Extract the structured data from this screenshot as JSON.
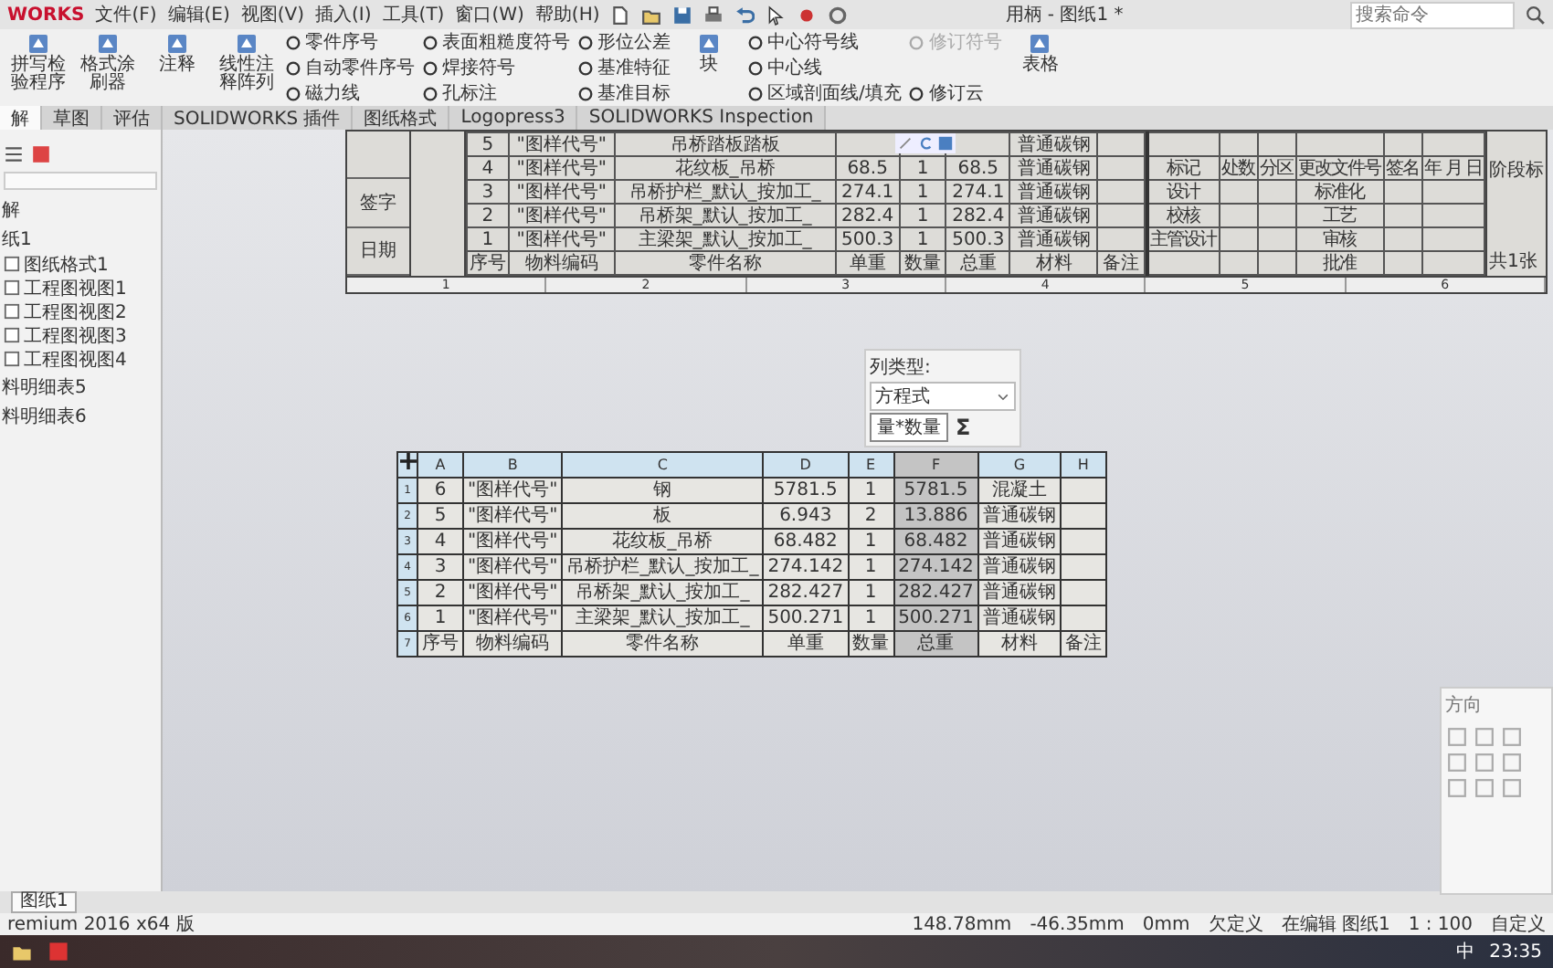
{
  "app": {
    "logo": "WORKS",
    "menus": [
      "文件(F)",
      "编辑(E)",
      "视图(V)",
      "插入(I)",
      "工具(T)",
      "窗口(W)",
      "帮助(H)"
    ],
    "title": "用柄 - 图纸1 *",
    "search": {
      "placeholder": "搜索命令"
    }
  },
  "ribbon": [
    {
      "kind": "large",
      "label": "拼写检验程序"
    },
    {
      "kind": "large",
      "label": "格式涂刷器"
    },
    {
      "kind": "large",
      "label": "注释"
    },
    {
      "kind": "large",
      "label": "线性注释阵列"
    },
    {
      "kind": "stack",
      "items": [
        {
          "label": "零件序号",
          "disabled": false
        },
        {
          "label": "自动零件序号",
          "disabled": false
        },
        {
          "label": "磁力线",
          "disabled": false
        }
      ]
    },
    {
      "kind": "stack",
      "items": [
        {
          "label": "表面粗糙度符号",
          "disabled": false
        },
        {
          "label": "焊接符号",
          "disabled": false
        },
        {
          "label": "孔标注",
          "disabled": false
        }
      ]
    },
    {
      "kind": "stack",
      "items": [
        {
          "label": "形位公差",
          "disabled": false
        },
        {
          "label": "基准特征",
          "disabled": false
        },
        {
          "label": "基准目标",
          "disabled": false
        }
      ]
    },
    {
      "kind": "large",
      "label": "块"
    },
    {
      "kind": "stack",
      "items": [
        {
          "label": "中心符号线",
          "disabled": false
        },
        {
          "label": "中心线",
          "disabled": false
        },
        {
          "label": "区域剖面线/填充",
          "disabled": false
        }
      ]
    },
    {
      "kind": "stack",
      "items": [
        {
          "label": "修订符号",
          "disabled": true
        },
        {
          "label": "修订云",
          "disabled": false
        }
      ]
    },
    {
      "kind": "large",
      "label": "表格"
    }
  ],
  "tabs": [
    {
      "label": "解",
      "selected": true
    },
    {
      "label": "草图",
      "selected": false
    },
    {
      "label": "评估",
      "selected": false
    },
    {
      "label": "SOLIDWORKS 插件",
      "selected": false
    },
    {
      "label": "图纸格式",
      "selected": false
    },
    {
      "label": "Logopress3",
      "selected": false
    },
    {
      "label": "SOLIDWORKS Inspection",
      "selected": false
    }
  ],
  "tree": [
    {
      "label": "解"
    },
    {
      "label": "纸1",
      "children": [
        {
          "label": "图纸格式1"
        },
        {
          "label": "工程图视图1"
        },
        {
          "label": "工程图视图2"
        },
        {
          "label": "工程图视图3"
        },
        {
          "label": "工程图视图4"
        }
      ]
    },
    {
      "label": "料明细表5"
    },
    {
      "label": "料明细表6"
    }
  ],
  "title_block": {
    "left_labels": [
      "签字",
      "日期"
    ],
    "bom_rows": [
      {
        "no": "5",
        "code": "\"图样代号\"",
        "name": "吊桥踏板踏板",
        "material": "普通碳钢"
      },
      {
        "no": "4",
        "code": "\"图样代号\"",
        "name": "花纹板_吊桥",
        "unit": "68.5",
        "qty": "1",
        "total": "68.5",
        "material": "普通碳钢"
      },
      {
        "no": "3",
        "code": "\"图样代号\"",
        "name": "吊桥护栏_默认_按加工_",
        "unit": "274.1",
        "qty": "1",
        "total": "274.1",
        "material": "普通碳钢"
      },
      {
        "no": "2",
        "code": "\"图样代号\"",
        "name": "吊桥架_默认_按加工_",
        "unit": "282.4",
        "qty": "1",
        "total": "282.4",
        "material": "普通碳钢"
      },
      {
        "no": "1",
        "code": "\"图样代号\"",
        "name": "主梁架_默认_按加工_",
        "unit": "500.3",
        "qty": "1",
        "total": "500.3",
        "material": "普通碳钢"
      }
    ],
    "bom_header": [
      "序号",
      "物料编码",
      "零件名称",
      "单重",
      "数量",
      "总重",
      "材料",
      "备注"
    ],
    "revision_header": [
      "标记",
      "处数",
      "分区",
      "更改文件号",
      "签名",
      "年 月 日"
    ],
    "approvals": [
      {
        "left": "设计",
        "right": "标准化"
      },
      {
        "left": "校核",
        "right": "工艺"
      },
      {
        "left": "主管设计",
        "right": "审核"
      },
      {
        "right": "批准"
      }
    ],
    "stage_label": "阶段标",
    "sheet_label": "共1张",
    "zones": [
      "1",
      "2",
      "3",
      "4",
      "5",
      "6"
    ]
  },
  "popup": {
    "label": "列类型:",
    "type": "方程式",
    "equation": "量*数量",
    "sum": "Σ"
  },
  "table": {
    "columns": [
      {
        "letter": "A",
        "selected": false
      },
      {
        "letter": "B",
        "selected": false
      },
      {
        "letter": "C",
        "selected": false
      },
      {
        "letter": "D",
        "selected": false
      },
      {
        "letter": "E",
        "selected": false
      },
      {
        "letter": "F",
        "selected": true
      },
      {
        "letter": "G",
        "selected": false
      },
      {
        "letter": "H",
        "selected": false
      }
    ],
    "row_numbers": [
      "1",
      "2",
      "3",
      "4",
      "5",
      "6",
      "7"
    ],
    "rows": [
      [
        "6",
        "\"图样代号\"",
        "钢",
        "5781.5",
        "1",
        "5781.5",
        "混凝土",
        ""
      ],
      [
        "5",
        "\"图样代号\"",
        "板",
        "6.943",
        "2",
        "13.886",
        "普通碳钢",
        ""
      ],
      [
        "4",
        "\"图样代号\"",
        "花纹板_吊桥",
        "68.482",
        "1",
        "68.482",
        "普通碳钢",
        ""
      ],
      [
        "3",
        "\"图样代号\"",
        "吊桥护栏_默认_按加工_",
        "274.142",
        "1",
        "274.142",
        "普通碳钢",
        ""
      ],
      [
        "2",
        "\"图样代号\"",
        "吊桥架_默认_按加工_",
        "282.427",
        "1",
        "282.427",
        "普通碳钢",
        ""
      ],
      [
        "1",
        "\"图样代号\"",
        "主梁架_默认_按加工_",
        "500.271",
        "1",
        "500.271",
        "普通碳钢",
        ""
      ],
      [
        "序号",
        "物料编码",
        "零件名称",
        "单重",
        "数量",
        "总重",
        "材料",
        "备注"
      ]
    ]
  },
  "orientation_panel": {
    "title": "方向"
  },
  "sheet_tab": "图纸1",
  "status": {
    "edition": "remium 2016 x64 版",
    "items": [
      "148.78mm",
      "-46.35mm",
      "0mm",
      "欠定义",
      "在编辑 图纸1",
      "1 : 100",
      "自定义"
    ]
  },
  "taskbar": {
    "ime": "中",
    "time": "23:35"
  }
}
